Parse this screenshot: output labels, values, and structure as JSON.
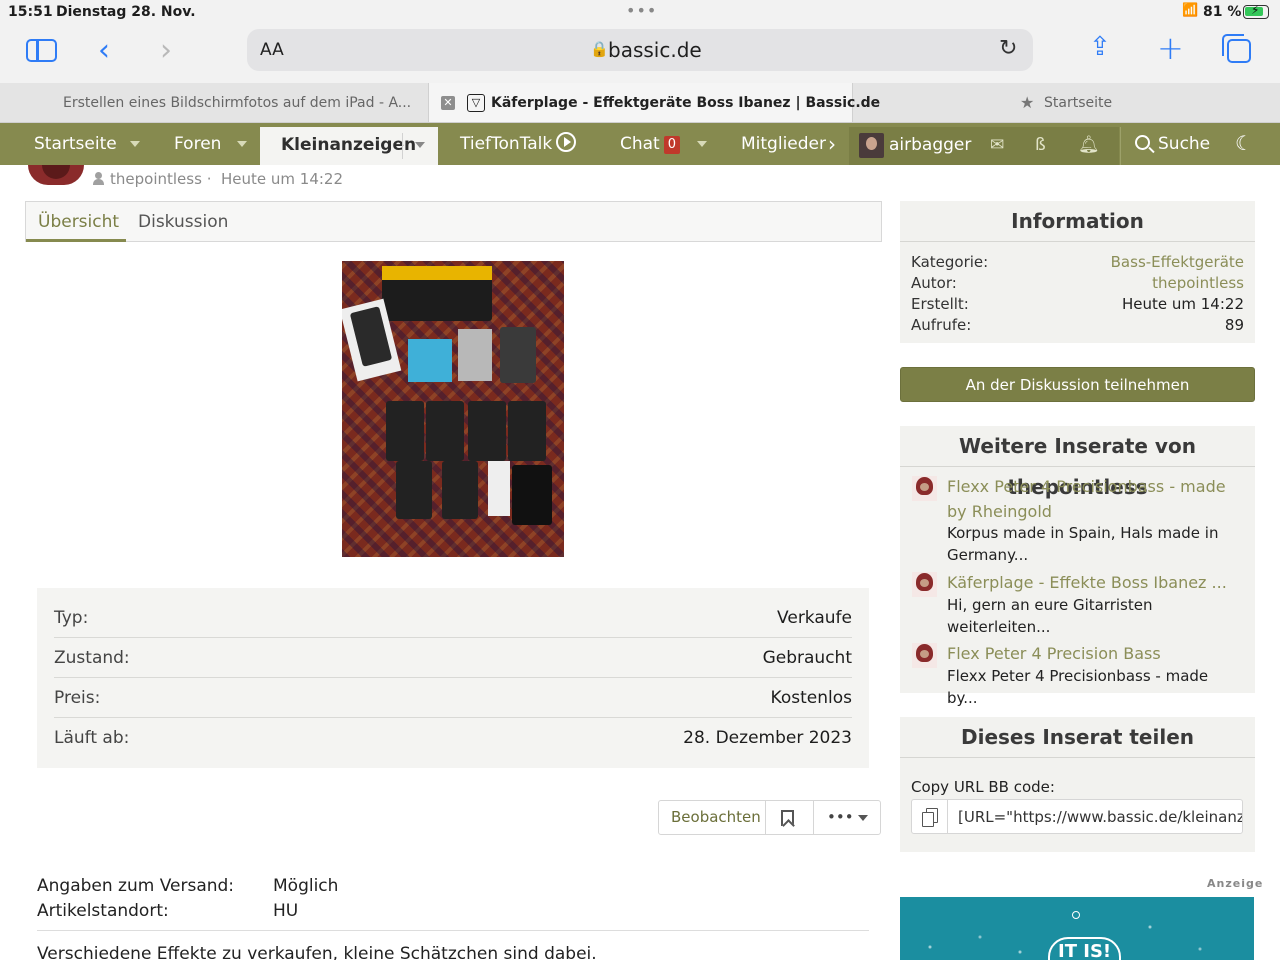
{
  "status_bar": {
    "time": "15:51",
    "date": "Dienstag 28. Nov.",
    "dots": "•••",
    "battery_percent": "81 %",
    "battery_level": 0.81
  },
  "safari": {
    "reader_label": "AA",
    "host": "bassic.de",
    "tabs": [
      {
        "label": "Erstellen eines Bildschirmfotos auf dem iPad - A..."
      },
      {
        "label": "Käferplage - Effektgeräte Boss Ibanez | Bassic.de"
      },
      {
        "label": "Startseite"
      }
    ]
  },
  "nav": {
    "items": [
      "Startseite",
      "Foren",
      "Kleinanzeigen",
      "TiefTonTalk",
      "Chat",
      "Mitglieder"
    ],
    "chat_count": "0",
    "user_name": "airbagger",
    "search_label": "Suche",
    "bassic_icon": "ß"
  },
  "listing": {
    "author": "thepointless",
    "time": "Heute um 14:22",
    "meta_separator": "·",
    "tabs": [
      "Übersicht",
      "Diskussion"
    ],
    "details": [
      {
        "key": "Typ:",
        "value": "Verkaufe"
      },
      {
        "key": "Zustand:",
        "value": "Gebraucht"
      },
      {
        "key": "Preis:",
        "value": "Kostenlos"
      },
      {
        "key": "Läuft ab:",
        "value": "28. Dezember 2023"
      }
    ],
    "actions": {
      "watch": "Beobachten",
      "more": "•••"
    },
    "shipping": [
      {
        "key": "Angaben zum Versand:",
        "value": "Möglich"
      },
      {
        "key": "Artikelstandort:",
        "value": "HU"
      }
    ],
    "description": "Verschiedene Effekte zu verkaufen, kleine Schätzchen sind dabei."
  },
  "sidebar": {
    "info": {
      "title": "Information",
      "rows": [
        {
          "key": "Kategorie:",
          "value": "Bass-Effektgeräte"
        },
        {
          "key": "Autor:",
          "value": "thepointless"
        },
        {
          "key": "Erstellt:",
          "value": "Heute um 14:22"
        },
        {
          "key": "Aufrufe:",
          "value": "89"
        }
      ]
    },
    "join_button": "An der Diskussion teilnehmen",
    "more": {
      "title": "Weitere Inserate von thepointless",
      "items": [
        {
          "title": "Flexx Peter 4 Precisionbass - made by Rheingold",
          "snippet": "Korpus made in Spain, Hals made in Germany..."
        },
        {
          "title": "Käferplage - Effekte Boss Ibanez ...",
          "snippet": "Hi, gern an eure Gitarristen weiterleiten..."
        },
        {
          "title": "Flex Peter 4 Precision Bass",
          "snippet": "Flexx Peter 4 Precisionbass - made by..."
        }
      ]
    },
    "share": {
      "title": "Dieses Inserat teilen",
      "label": "Copy URL BB code:",
      "value": "[URL=\"https://www.bassic.de/kleinanze"
    },
    "ad_label": "Anzeige",
    "ad_text": "IT IS!"
  }
}
